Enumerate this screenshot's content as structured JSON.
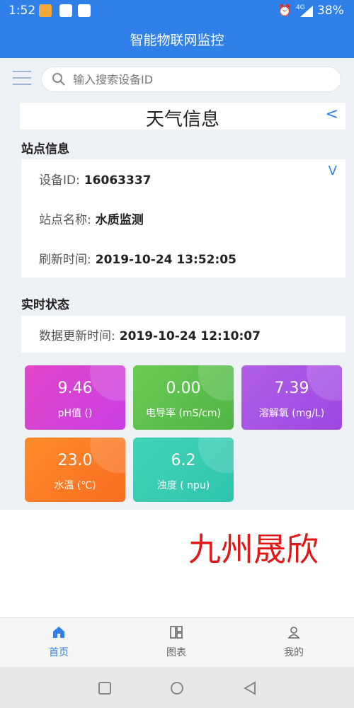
{
  "status_bar": {
    "time": "1:52",
    "network": "4G",
    "battery": "38%"
  },
  "app_bar": {
    "title": "智能物联网监控"
  },
  "search": {
    "placeholder": "输入搜索设备ID"
  },
  "weather_header": {
    "title": "天气信息",
    "back_symbol": "<"
  },
  "station_info": {
    "section_title": "站点信息",
    "expand_symbol": "V",
    "device_id_label": "设备ID:",
    "device_id_value": "16063337",
    "station_name_label": "站点名称:",
    "station_name_value": "水质监测",
    "refresh_time_label": "刷新时间:",
    "refresh_time_value": "2019-10-24 13:52:05"
  },
  "realtime_status": {
    "section_title": "实时状态",
    "update_time_label": "数据更新时间:",
    "update_time_value": "2019-10-24 12:10:07"
  },
  "metrics": [
    {
      "value": "9.46",
      "label": "pH值 ()",
      "color": "#d943d6"
    },
    {
      "value": "0.00",
      "label": "电导率 (mS/cm)",
      "color": "#5cbf4d"
    },
    {
      "value": "7.39",
      "label": "溶解氧 (mg/L)",
      "color": "#a853e4"
    },
    {
      "value": "23.0",
      "label": "水温 (℃)",
      "color": "#fb7a26"
    },
    {
      "value": "6.2",
      "label": "浊度 ( npu)",
      "color": "#38ccb1"
    }
  ],
  "watermark": "九州晟欣",
  "bottom_nav": {
    "home": "首页",
    "chart": "图表",
    "mine": "我的",
    "active_color": "#2f80e9"
  }
}
